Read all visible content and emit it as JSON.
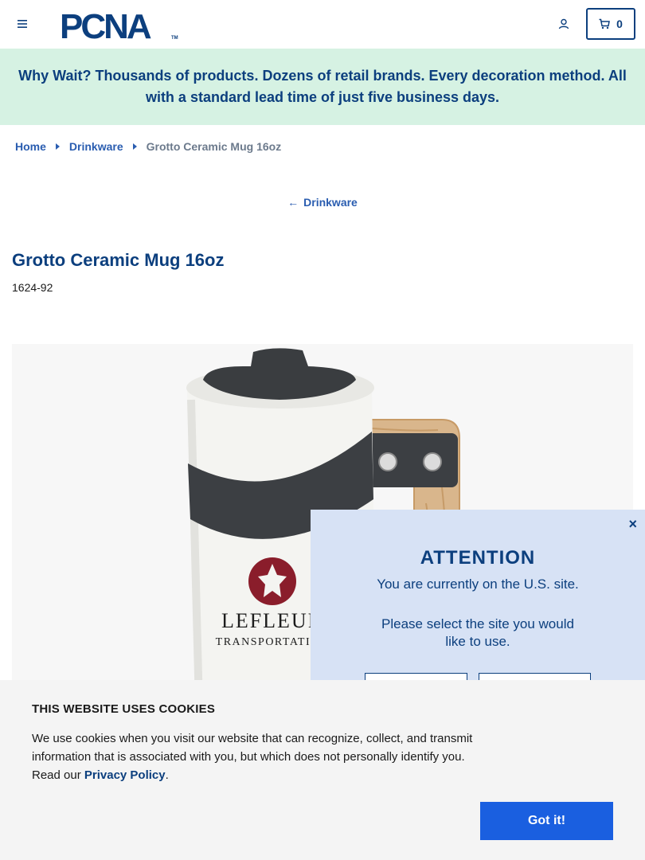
{
  "header": {
    "logo_text": "PCNA",
    "logo_mark": "TM",
    "cart_count": "0"
  },
  "promo": {
    "text": "Why Wait? Thousands of products. Dozens of retail brands. Every decoration method. All with a standard lead time of just five business days."
  },
  "breadcrumb": {
    "items": [
      "Home",
      "Drinkware"
    ],
    "current": "Grotto Ceramic Mug 16oz"
  },
  "back_link": {
    "arrow": "←",
    "label": "Drinkware"
  },
  "product": {
    "title": "Grotto Ceramic Mug 16oz",
    "sku": "1624-92",
    "image_imprint_line1": "LEFLEUR",
    "image_imprint_line2": "TRANSPORTATION"
  },
  "attention": {
    "close": "×",
    "title": "ATTENTION",
    "message": "You are currently on the U.S. site.",
    "select_prompt": "Please select the site you would like to use."
  },
  "cookie": {
    "title": "THIS WEBSITE USES COOKIES",
    "text_before_link": "We use cookies when you visit our website that can recognize, collect, and transmit information that is associated with you, but which does not personally identify you. Read our ",
    "link_text": "Privacy Policy",
    "text_after_link": ".",
    "button_label": "Got it!"
  },
  "colors": {
    "brand_navy": "#0c3f7e",
    "link_blue": "#2a5db0",
    "promo_bg": "#d6f2e3",
    "modal_bg": "#d7e2f5",
    "cookie_button": "#1a5fe0"
  }
}
